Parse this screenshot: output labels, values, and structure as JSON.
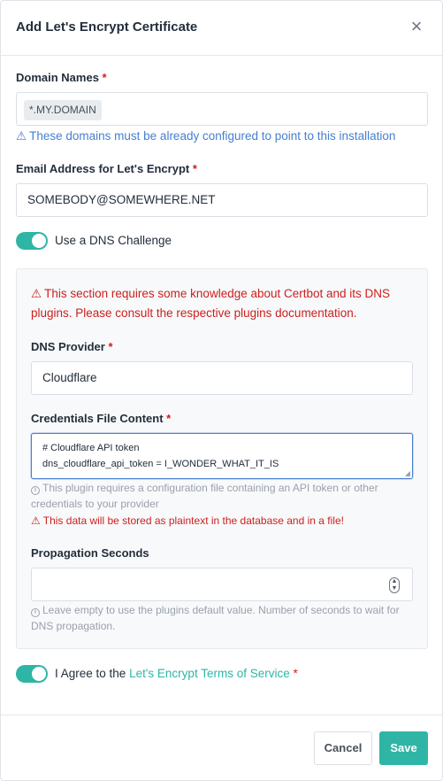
{
  "modal": {
    "title": "Add Let's Encrypt Certificate",
    "close_glyph": "×"
  },
  "domain_names": {
    "label": "Domain Names",
    "required_mark": "*",
    "tag": "*.MY.DOMAIN",
    "hint_icon": "alert-triangle-icon",
    "hint": "These domains must be already configured to point to this installation"
  },
  "email": {
    "label": "Email Address for Let's Encrypt",
    "required_mark": "*",
    "value": "SOMEBODY@SOMEWHERE.NET"
  },
  "dns_challenge": {
    "label": "Use a DNS Challenge",
    "enabled": true
  },
  "dns_section": {
    "warning_line1": "This section requires some knowledge about Certbot and its DNS",
    "warning_line2": "plugins. Please consult the respective plugins documentation.",
    "provider": {
      "label": "DNS Provider",
      "required_mark": "*",
      "value": "Cloudflare"
    },
    "credentials": {
      "label": "Credentials File Content",
      "required_mark": "*",
      "line1": "# Cloudflare API token",
      "line2": "dns_cloudflare_api_token = I_WONDER_WHAT_IT_IS",
      "info_line1": "This plugin requires a configuration file containing an API token or other",
      "info_line2": "credentials to your provider",
      "warning": "This data will be stored as plaintext in the database and in a file!"
    },
    "propagation": {
      "label": "Propagation Seconds",
      "value": "",
      "info_line1": "Leave empty to use the plugins default value. Number of seconds to wait for",
      "info_line2": "DNS propagation."
    }
  },
  "agree": {
    "prefix": "I Agree to the",
    "link": "Let's Encrypt Terms of Service",
    "required_mark": "*",
    "enabled": true
  },
  "footer": {
    "cancel_label": "Cancel",
    "save_label": "Save"
  },
  "colors": {
    "accent": "#2fb5a5",
    "danger": "#cd201f",
    "info": "#467fcf"
  }
}
